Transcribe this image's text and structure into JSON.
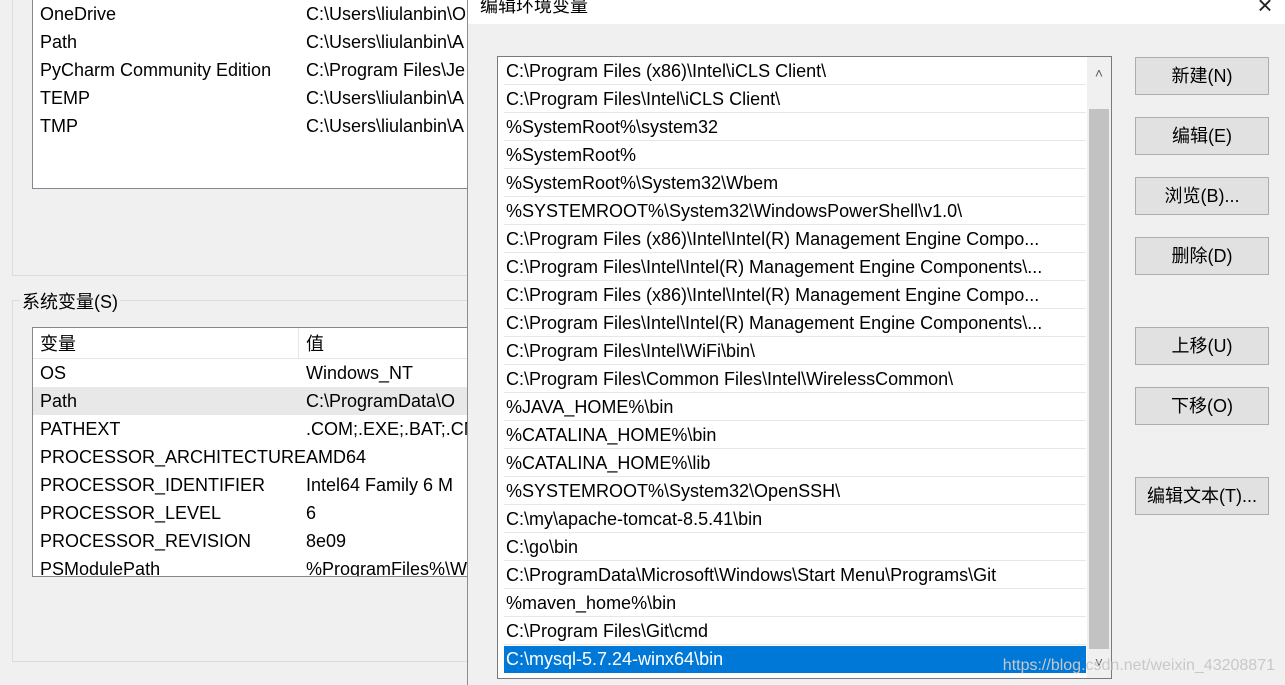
{
  "user_vars": {
    "rows": [
      {
        "name": "OneDrive",
        "value": "C:\\Users\\liulanbin\\O"
      },
      {
        "name": "Path",
        "value": "C:\\Users\\liulanbin\\A"
      },
      {
        "name": "PyCharm Community Edition",
        "value": "C:\\Program Files\\Je"
      },
      {
        "name": "TEMP",
        "value": "C:\\Users\\liulanbin\\A"
      },
      {
        "name": "TMP",
        "value": "C:\\Users\\liulanbin\\A"
      }
    ]
  },
  "system_vars": {
    "label": "系统变量(S)",
    "col_name": "变量",
    "col_value": "值",
    "rows": [
      {
        "name": "OS",
        "value": "Windows_NT"
      },
      {
        "name": "Path",
        "value": "C:\\ProgramData\\O"
      },
      {
        "name": "PATHEXT",
        "value": ".COM;.EXE;.BAT;.CM"
      },
      {
        "name": "PROCESSOR_ARCHITECTURE",
        "value": "AMD64"
      },
      {
        "name": "PROCESSOR_IDENTIFIER",
        "value": "Intel64 Family 6 M"
      },
      {
        "name": "PROCESSOR_LEVEL",
        "value": "6"
      },
      {
        "name": "PROCESSOR_REVISION",
        "value": "8e09"
      },
      {
        "name": "PSModulePath",
        "value": "%ProgramFiles%\\W"
      }
    ]
  },
  "dialog": {
    "title": "编辑环境变量",
    "close_icon": "×",
    "paths": [
      "C:\\Program Files (x86)\\Intel\\iCLS Client\\",
      "C:\\Program Files\\Intel\\iCLS Client\\",
      "%SystemRoot%\\system32",
      "%SystemRoot%",
      "%SystemRoot%\\System32\\Wbem",
      "%SYSTEMROOT%\\System32\\WindowsPowerShell\\v1.0\\",
      "C:\\Program Files (x86)\\Intel\\Intel(R) Management Engine Compo...",
      "C:\\Program Files\\Intel\\Intel(R) Management Engine Components\\...",
      "C:\\Program Files (x86)\\Intel\\Intel(R) Management Engine Compo...",
      "C:\\Program Files\\Intel\\Intel(R) Management Engine Components\\...",
      "C:\\Program Files\\Intel\\WiFi\\bin\\",
      "C:\\Program Files\\Common Files\\Intel\\WirelessCommon\\",
      "%JAVA_HOME%\\bin",
      "%CATALINA_HOME%\\bin",
      "%CATALINA_HOME%\\lib",
      "%SYSTEMROOT%\\System32\\OpenSSH\\",
      "C:\\my\\apache-tomcat-8.5.41\\bin",
      "C:\\go\\bin",
      "C:\\ProgramData\\Microsoft\\Windows\\Start Menu\\Programs\\Git",
      "%maven_home%\\bin",
      "C:\\Program Files\\Git\\cmd",
      "C:\\mysql-5.7.24-winx64\\bin"
    ],
    "selected_index": 21,
    "buttons": {
      "new": "新建(N)",
      "edit": "编辑(E)",
      "browse": "浏览(B)...",
      "delete": "删除(D)",
      "move_up": "上移(U)",
      "move_down": "下移(O)",
      "edit_text": "编辑文本(T)..."
    }
  },
  "watermark": "https://blog.csdn.net/weixin_43208871"
}
